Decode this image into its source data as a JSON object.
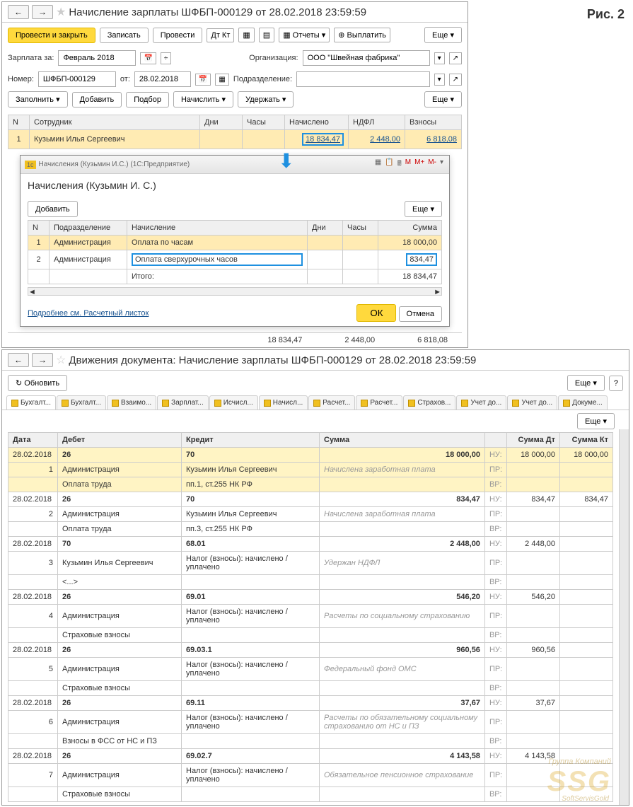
{
  "fig": "Рис. 2",
  "top": {
    "title": "Начисление зарплаты ШФБП-000129 от 28.02.2018 23:59:59",
    "nav_back": "←",
    "nav_fwd": "→",
    "btn_post_close": "Провести и закрыть",
    "btn_write": "Записать",
    "btn_post": "Провести",
    "btn_reports": "Отчеты",
    "btn_pay": "Выплатить",
    "btn_more": "Еще",
    "lbl_salary_for": "Зарплата за:",
    "period": "Февраль 2018",
    "lbl_org": "Организация:",
    "org": "ООО \"Швейная фабрика\"",
    "lbl_number": "Номер:",
    "number": "ШФБП-000129",
    "lbl_from": "от:",
    "date": "28.02.2018",
    "lbl_dept": "Подразделение:",
    "bar2": {
      "fill": "Заполнить",
      "add": "Добавить",
      "pick": "Подбор",
      "accrue": "Начислить",
      "dedu": "Удержать",
      "more": "Еще"
    },
    "cols": {
      "n": "N",
      "emp": "Сотрудник",
      "days": "Дни",
      "hours": "Часы",
      "accr": "Начислено",
      "ndfl": "НДФЛ",
      "contr": "Взносы"
    },
    "row": {
      "n": "1",
      "emp": "Кузьмин Илья Сергеевич",
      "accr": "18 834,47",
      "ndfl": "2 448,00",
      "contr": "6 818,08"
    },
    "totals": {
      "accr": "18 834,47",
      "ndfl": "2 448,00",
      "contr": "6 818,08"
    }
  },
  "popup": {
    "wtitle": "Начисления (Кузьмин И.С.) (1С:Предприятие)",
    "title": "Начисления (Кузьмин И. С.)",
    "add": "Добавить",
    "more": "Еще",
    "cols": {
      "n": "N",
      "dept": "Подразделение",
      "accr": "Начисление",
      "days": "Дни",
      "hours": "Часы",
      "sum": "Сумма"
    },
    "rows": [
      {
        "n": "1",
        "dept": "Администрация",
        "accr": "Оплата по часам",
        "sum": "18 000,00"
      },
      {
        "n": "2",
        "dept": "Администрация",
        "accr": "Оплата сверхурочных часов",
        "sum": "834,47"
      }
    ],
    "total_lbl": "Итого:",
    "total": "18 834,47",
    "detail_link": "Подробнее см. Расчетный листок",
    "ok": "ОК",
    "cancel": "Отмена",
    "calc": [
      "M",
      "M+",
      "M-"
    ]
  },
  "bottom": {
    "title": "Движения документа: Начисление зарплаты ШФБП-000129 от 28.02.2018 23:59:59",
    "refresh": "Обновить",
    "more": "Еще",
    "help": "?",
    "tabs": [
      "Бухгалт...",
      "Бухгалт...",
      "Взаимо...",
      "Зарплат...",
      "Исчисл...",
      "Начисл...",
      "Расчет...",
      "Расчет...",
      "Страхов...",
      "Учет до...",
      "Учет до...",
      "Докуме..."
    ],
    "more2": "Еще",
    "hdr": {
      "date": "Дата",
      "debit": "Дебет",
      "credit": "Кредит",
      "sum": "Сумма",
      "dt": "Сумма Дт",
      "kt": "Сумма Кт"
    },
    "sidelabels": {
      "nu": "НУ:",
      "pr": "ПР:",
      "vr": "ВР:"
    },
    "entries": [
      {
        "hl": true,
        "date": "28.02.2018",
        "n": "1",
        "d1": "26",
        "d2": "Администрация",
        "d3": "Оплата труда",
        "c1": "70",
        "c2": "Кузьмин Илья Сергеевич",
        "c3": "пп.1, ст.255 НК РФ",
        "desc": "Начислена заработная плата",
        "sum": "18 000,00",
        "dt": "18 000,00",
        "kt": "18 000,00"
      },
      {
        "date": "28.02.2018",
        "n": "2",
        "d1": "26",
        "d2": "Администрация",
        "d3": "Оплата труда",
        "c1": "70",
        "c2": "Кузьмин Илья Сергеевич",
        "c3": "пп.3, ст.255 НК РФ",
        "desc": "Начислена заработная плата",
        "sum": "834,47",
        "dt": "834,47",
        "kt": "834,47"
      },
      {
        "date": "28.02.2018",
        "n": "3",
        "d1": "70",
        "d2": "Кузьмин Илья Сергеевич",
        "d3": "<...>",
        "c1": "68.01",
        "c2": "Налог (взносы): начислено / уплачено",
        "c3": "",
        "desc": "Удержан НДФЛ",
        "sum": "2 448,00",
        "dt": "2 448,00",
        "kt": ""
      },
      {
        "date": "28.02.2018",
        "n": "4",
        "d1": "26",
        "d2": "Администрация",
        "d3": "Страховые взносы",
        "c1": "69.01",
        "c2": "Налог (взносы): начислено / уплачено",
        "c3": "",
        "desc": "Расчеты по социальному страхованию",
        "sum": "546,20",
        "dt": "546,20",
        "kt": ""
      },
      {
        "date": "28.02.2018",
        "n": "5",
        "d1": "26",
        "d2": "Администрация",
        "d3": "Страховые взносы",
        "c1": "69.03.1",
        "c2": "Налог (взносы): начислено / уплачено",
        "c3": "",
        "desc": "Федеральный фонд ОМС",
        "sum": "960,56",
        "dt": "960,56",
        "kt": ""
      },
      {
        "date": "28.02.2018",
        "n": "6",
        "d1": "26",
        "d2": "Администрация",
        "d3": "Взносы в ФСС от НС и ПЗ",
        "c1": "69.11",
        "c2": "Налог (взносы): начислено / уплачено",
        "c3": "",
        "desc": "Расчеты по обязательному социальному страхованию от НС и ПЗ",
        "sum": "37,67",
        "dt": "37,67",
        "kt": ""
      },
      {
        "date": "28.02.2018",
        "n": "7",
        "d1": "26",
        "d2": "Администрация",
        "d3": "Страховые взносы",
        "c1": "69.02.7",
        "c2": "Налог (взносы): начислено / уплачено",
        "c3": "",
        "desc": "Обязательное пенсионное страхование",
        "sum": "4 143,58",
        "dt": "4 143,58",
        "kt": ""
      }
    ]
  },
  "watermark": {
    "big": "SSG",
    "small1": "Группа Компаний",
    "small2": "SoftServisGold"
  }
}
